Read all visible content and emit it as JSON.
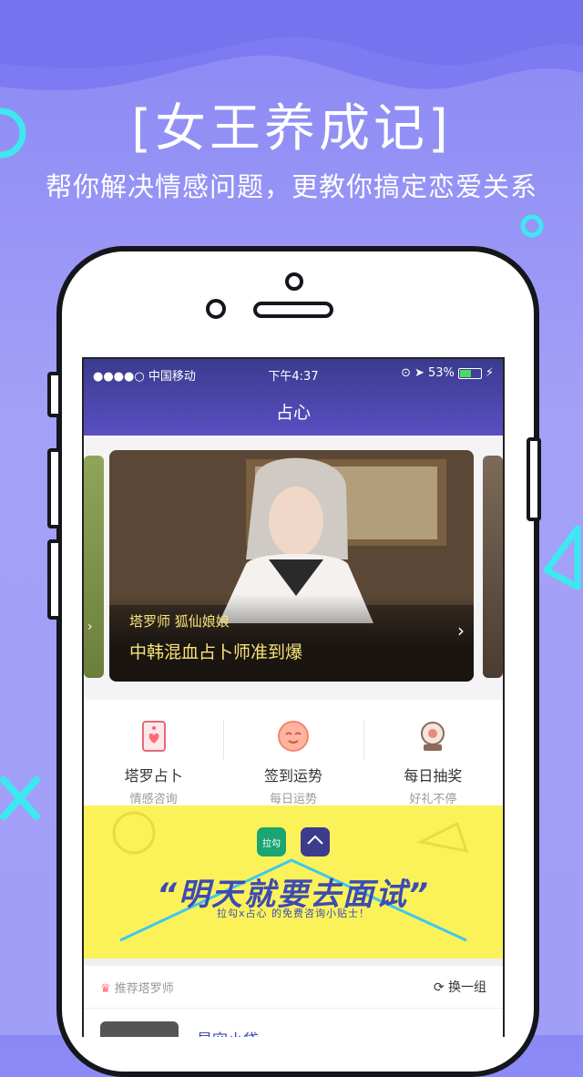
{
  "promo": {
    "title": "[女王养成记]",
    "subtitle": "帮你解决情感问题，更教你搞定恋爱关系"
  },
  "status_bar": {
    "carrier": "●●●●○ 中国移动",
    "wifi_icon": "wifi-icon",
    "time": "下午4:37",
    "battery": "53%"
  },
  "nav": {
    "title": "占心"
  },
  "carousel": {
    "card": {
      "name": "塔罗师 狐仙娘娘",
      "caption": "中韩混血占卜师准到爆"
    }
  },
  "features": [
    {
      "title": "塔罗占卜",
      "sub": "情感咨询",
      "icon": "tarot-card-icon"
    },
    {
      "title": "签到运势",
      "sub": "每日运势",
      "icon": "smiley-face-icon"
    },
    {
      "title": "每日抽奖",
      "sub": "好礼不停",
      "icon": "crystal-ball-icon"
    }
  ],
  "banner": {
    "headline": "“明天就要去面试”",
    "sub": "拉勾x占心 的免费咨询小贴士！",
    "badge_left": "拉勾"
  },
  "recommend": {
    "title": "推荐塔罗师",
    "refresh": "换一组",
    "teacher_name": "星空小袋"
  },
  "colors": {
    "accent": "#5a4fc2",
    "banner": "#fbf25a",
    "gold_text": "#f6e27a"
  }
}
